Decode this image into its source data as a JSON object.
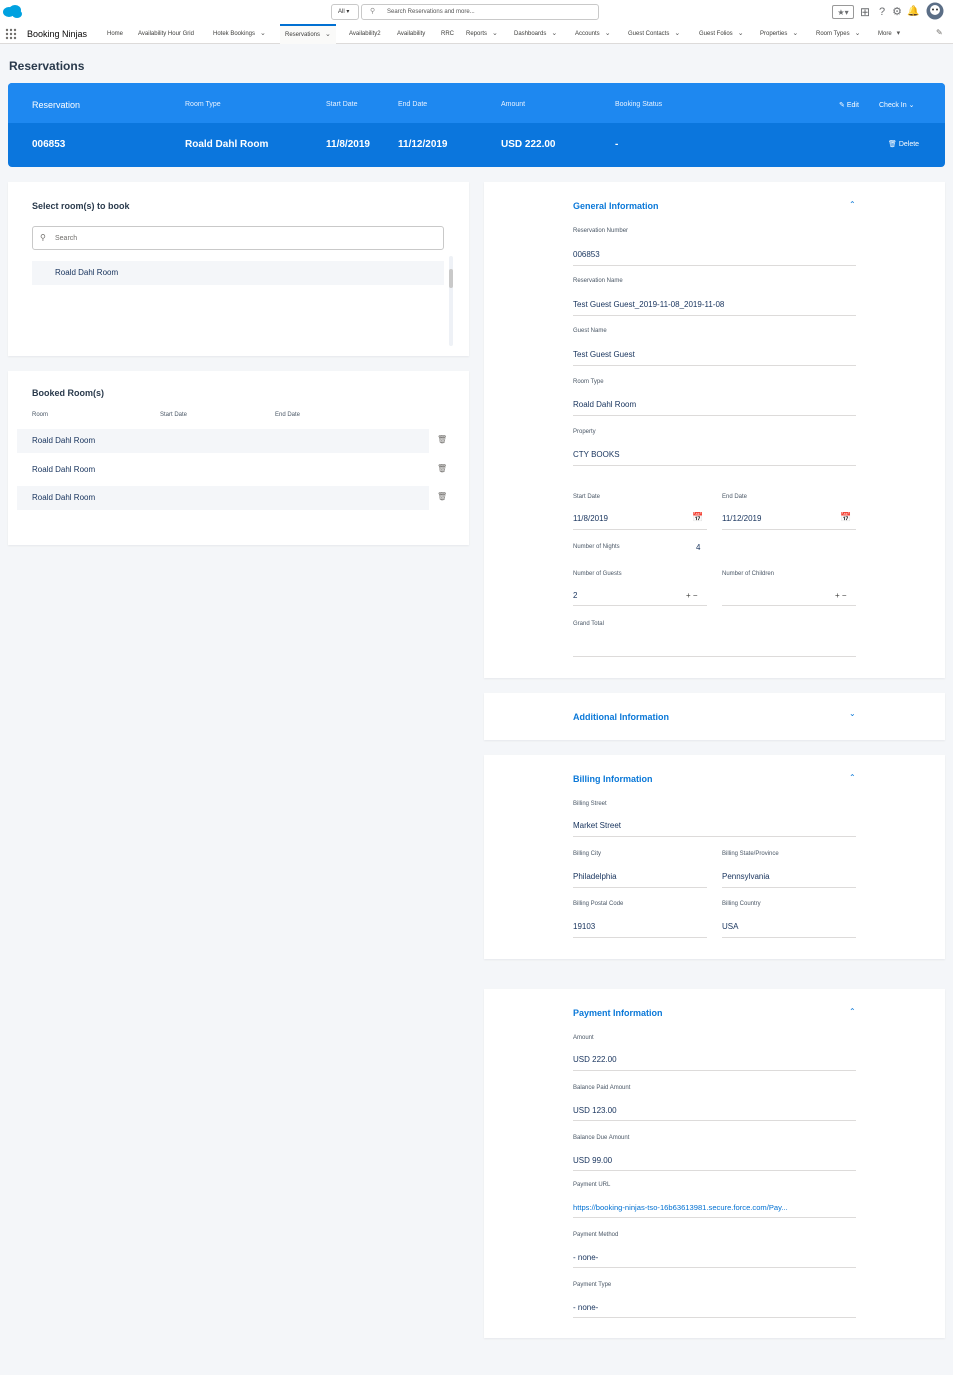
{
  "header": {
    "scope_label": "All",
    "search_placeholder": "Search Reservations and more..."
  },
  "nav": {
    "app_name": "Booking Ninjas",
    "items": [
      "Home",
      "Availability Hour Grid",
      "Hotek Bookings",
      "Reservations",
      "Availability2",
      "Availability",
      "RRC",
      "Reports",
      "Dashboards",
      "Accounts",
      "Guest Contacts",
      "Guest Folios",
      "Properties",
      "Room Types",
      "More"
    ]
  },
  "page": {
    "title": "Reservations"
  },
  "banner": {
    "headers": [
      "Reservation",
      "Room Type",
      "Start Date",
      "End Date",
      "Amount",
      "Booking Status"
    ],
    "values": [
      "006853",
      "Roald Dahl Room",
      "11/8/2019",
      "11/12/2019",
      "USD 222.00",
      "-"
    ],
    "edit_label": "Edit",
    "checkin_label": "Check In",
    "delete_label": "Delete"
  },
  "select_rooms": {
    "title": "Select room(s) to book",
    "search_placeholder": "Search",
    "items": [
      "Roald Dahl Room"
    ]
  },
  "booked_rooms": {
    "title": "Booked Room(s)",
    "columns": [
      "Room",
      "Start Date",
      "End Date"
    ],
    "rows": [
      "Roald Dahl Room",
      "Roald Dahl Room",
      "Roald Dahl Room"
    ]
  },
  "general": {
    "title": "General Information",
    "reservation_number_label": "Reservation Number",
    "reservation_number": "006853",
    "reservation_name_label": "Reservation Name",
    "reservation_name": "Test Guest Guest_2019-11-08_2019-11-08",
    "guest_name_label": "Guest Name",
    "guest_name": "Test Guest Guest",
    "room_type_label": "Room Type",
    "room_type": "Roald Dahl Room",
    "property_label": "Property",
    "property": "CTY BOOKS",
    "start_date_label": "Start Date",
    "start_date": "11/8/2019",
    "end_date_label": "End Date",
    "end_date": "11/12/2019",
    "nights_label": "Number of Nights",
    "nights": "4",
    "guests_label": "Number of Guests",
    "guests": "2",
    "children_label": "Number of Children",
    "children": "",
    "grand_total_label": "Grand Total",
    "grand_total": ""
  },
  "additional": {
    "title": "Additional Information"
  },
  "billing": {
    "title": "Billing Information",
    "street_label": "Billing Street",
    "street": "Market Street",
    "city_label": "Billing City",
    "city": "Philadelphia",
    "state_label": "Billing State/Province",
    "state": "Pennsylvania",
    "postal_label": "Billing Postal Code",
    "postal": "19103",
    "country_label": "Billing Country",
    "country": "USA"
  },
  "payment": {
    "title": "Payment Information",
    "amount_label": "Amount",
    "amount": "USD 222.00",
    "paid_label": "Balance Paid Amount",
    "paid": "USD 123.00",
    "due_label": "Balance Due Amount",
    "due": "USD 99.00",
    "url_label": "Payment URL",
    "url": "https://booking-ninjas-tso-16b63613981.secure.force.com/Pay...",
    "method_label": "Payment Method",
    "method": "- none-",
    "type_label": "Payment Type",
    "type": "- none-"
  },
  "colors": {
    "brand": "#0b76dd",
    "accent": "#0a78d8",
    "link": "#0070d2"
  }
}
